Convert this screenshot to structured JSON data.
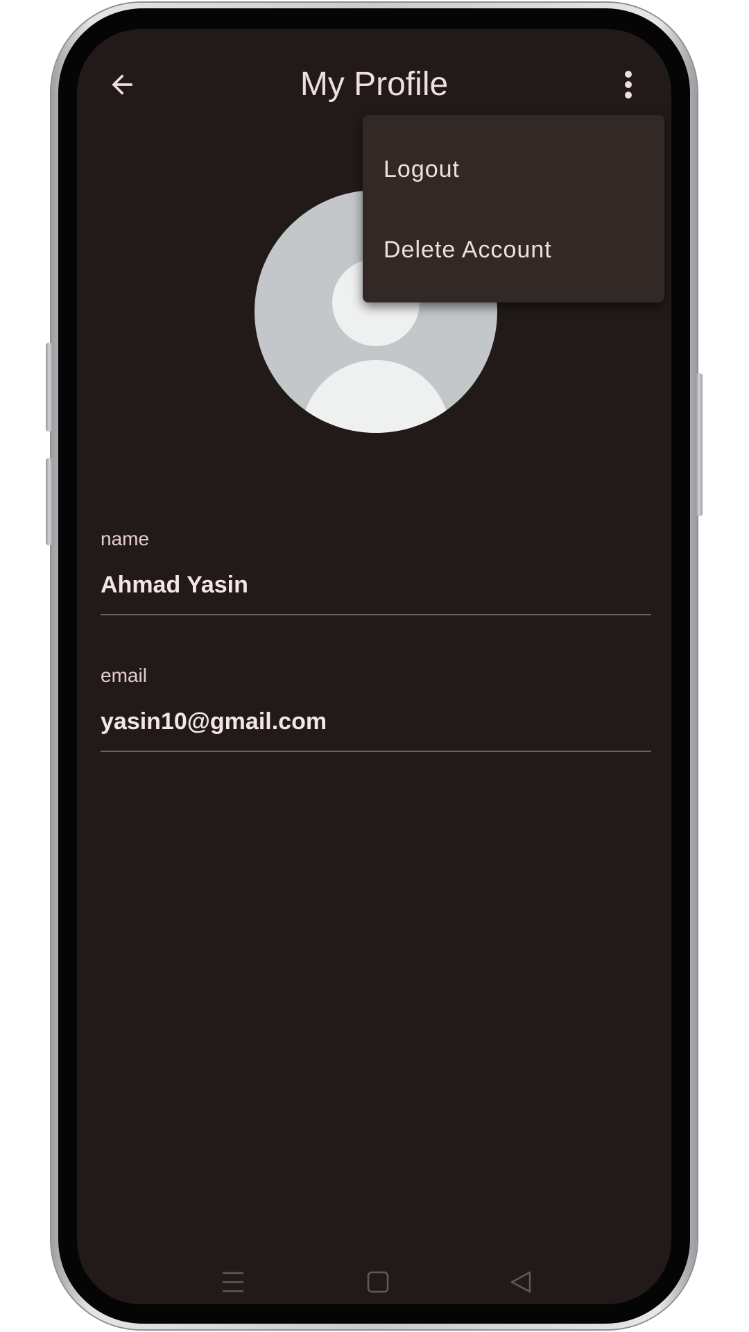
{
  "app": {
    "title": "My Profile"
  },
  "top_bar": {
    "back_icon": "arrow-back-icon",
    "more_icon": "more-vert-icon"
  },
  "menu": {
    "items": [
      {
        "label": "Logout"
      },
      {
        "label": "Delete Account"
      }
    ]
  },
  "avatar": {
    "icon": "default-user-avatar"
  },
  "fields": {
    "name": {
      "label": "name",
      "value": "Ahmad Yasin"
    },
    "email": {
      "label": "email",
      "value": "yasin10@gmail.com"
    }
  },
  "system_nav": {
    "items": [
      "menu-icon",
      "home-icon",
      "back-triangle-icon"
    ]
  },
  "colors": {
    "background": "#211a19",
    "text": "#f0dfdc",
    "menu_background": "#322927",
    "divider": "#6b6362",
    "avatar_background": "#c3c7c9",
    "avatar_foreground": "#eff0f0"
  }
}
